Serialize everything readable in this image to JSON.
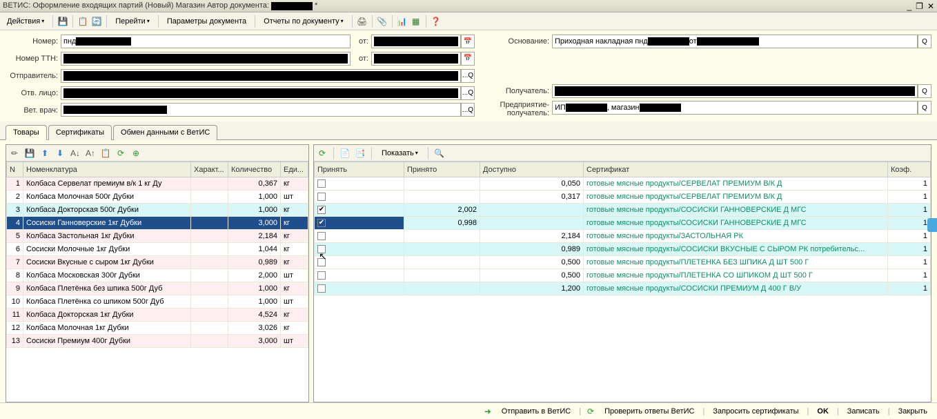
{
  "title_prefix": "ВЕТИС: Оформление входящих партий (Новый)  Магазин Автор документа: ",
  "title_suffix": " *",
  "menu": {
    "actions": "Действия",
    "go": "Перейти",
    "params": "Параметры документа",
    "reports": "Отчеты по документу"
  },
  "form": {
    "number": "Номер:",
    "number_prefix": "пнд",
    "from": "от:",
    "ttn": "Номер ТТН:",
    "sender": "Отправитель:",
    "resp": "Отв. лицо:",
    "vet": "Вет. врач:",
    "basis": "Основание:",
    "basis_text_prefix": "Приходная накладная пнд",
    "basis_text_mid": "от",
    "recipient": "Получатель:",
    "enterprise": "Предприятие-получатель:",
    "enterprise_text_prefix": "ИП",
    "enterprise_text_mid": ", магазин"
  },
  "tabs": {
    "goods": "Товары",
    "certs": "Сертификаты",
    "exchange": "Обмен данными с ВетИС"
  },
  "right_toolbar": {
    "show": "Показать"
  },
  "left_headers": {
    "n": "N",
    "nom": "Номенклатура",
    "char": "Характ...",
    "qty": "Количество",
    "unit": "Еди..."
  },
  "right_headers": {
    "accept": "Принять",
    "accepted": "Принято",
    "available": "Доступно",
    "cert": "Сертификат",
    "coef": "Коэф."
  },
  "cert_prefix": "готовые мясные продукты/",
  "left_rows": [
    {
      "n": "1",
      "nom": "Колбаса Сервелат премиум в/к 1 кг Ду",
      "qty": "0,367",
      "unit": "кг",
      "cls": "even-pink"
    },
    {
      "n": "2",
      "nom": "Колбаса Молочная 500г Дубки",
      "qty": "1,000",
      "unit": "шт",
      "cls": ""
    },
    {
      "n": "3",
      "nom": "Колбаса Докторская 500г Дубки",
      "qty": "1,000",
      "unit": "кг",
      "cls": "even-cyan"
    },
    {
      "n": "4",
      "nom": "Сосиски Ганноверские 1кг Дубки",
      "qty": "3,000",
      "unit": "кг",
      "cls": "selected"
    },
    {
      "n": "5",
      "nom": "Колбаса Застольная 1кг Дубки",
      "qty": "2,184",
      "unit": "кг",
      "cls": "even-pink"
    },
    {
      "n": "6",
      "nom": "Сосиски Молочные 1кг Дубки",
      "qty": "1,044",
      "unit": "кг",
      "cls": ""
    },
    {
      "n": "7",
      "nom": "Сосиски Вкусные с сыром 1кг Дубки",
      "qty": "0,989",
      "unit": "кг",
      "cls": "even-pink"
    },
    {
      "n": "8",
      "nom": "Колбаса Московская 300г Дубки",
      "qty": "2,000",
      "unit": "шт",
      "cls": ""
    },
    {
      "n": "9",
      "nom": "Колбаса Плетёнка без шпика 500г Дуб",
      "qty": "1,000",
      "unit": "кг",
      "cls": "even-pink"
    },
    {
      "n": "10",
      "nom": "Колбаса Плетёнка со шпиком 500г Дуб",
      "qty": "1,000",
      "unit": "шт",
      "cls": ""
    },
    {
      "n": "11",
      "nom": "Колбаса Докторская 1кг Дубки",
      "qty": "4,524",
      "unit": "кг",
      "cls": "even-pink"
    },
    {
      "n": "12",
      "nom": "Колбаса Молочная 1кг Дубки",
      "qty": "3,026",
      "unit": "кг",
      "cls": ""
    },
    {
      "n": "13",
      "nom": "Сосиски Премиум 400г Дубки",
      "qty": "3,000",
      "unit": "шт",
      "cls": "even-pink"
    }
  ],
  "right_rows": [
    {
      "chk": false,
      "accepted": "",
      "available": "0,050",
      "cert": "СЕРВЕЛАТ ПРЕМИУМ В/К Д",
      "coef": "1",
      "cls": ""
    },
    {
      "chk": false,
      "accepted": "",
      "available": "0,317",
      "cert": "СЕРВЕЛАТ ПРЕМИУМ В/К Д",
      "coef": "1",
      "cls": ""
    },
    {
      "chk": true,
      "accepted": "2,002",
      "available": "",
      "cert": "СОСИСКИ ГАННОВЕРСКИЕ Д МГС",
      "coef": "1",
      "cls": "even-cyan"
    },
    {
      "chk": true,
      "accepted": "0,998",
      "available": "",
      "cert": "СОСИСКИ ГАННОВЕРСКИЕ Д МГС",
      "coef": "1",
      "cls": "cyan-selected"
    },
    {
      "chk": false,
      "accepted": "",
      "available": "2,184",
      "cert": "ЗАСТОЛЬНАЯ РК",
      "coef": "1",
      "cls": ""
    },
    {
      "chk": false,
      "accepted": "",
      "available": "0,989",
      "cert": "СОСИСКИ ВКУСНЫЕ С СЫРОМ РК потребительс...",
      "coef": "1",
      "cls": "even-cyan"
    },
    {
      "chk": false,
      "accepted": "",
      "available": "0,500",
      "cert": "ПЛЕТЕНКА БЕЗ ШПИКА Д ШТ 500 Г",
      "coef": "1",
      "cls": ""
    },
    {
      "chk": false,
      "accepted": "",
      "available": "0,500",
      "cert": "ПЛЕТЕНКА СО ШПИКОМ Д ШТ 500 Г",
      "coef": "1",
      "cls": ""
    },
    {
      "chk": false,
      "accepted": "",
      "available": "1,200",
      "cert": "СОСИСКИ ПРЕМИУМ Д 400 Г В/У",
      "coef": "1",
      "cls": "even-cyan"
    }
  ],
  "footer": {
    "send": "Отправить в ВетИС",
    "check": "Проверить ответы ВетИС",
    "request": "Запросить сертификаты",
    "ok": "OK",
    "save": "Записать",
    "close": "Закрыть"
  }
}
